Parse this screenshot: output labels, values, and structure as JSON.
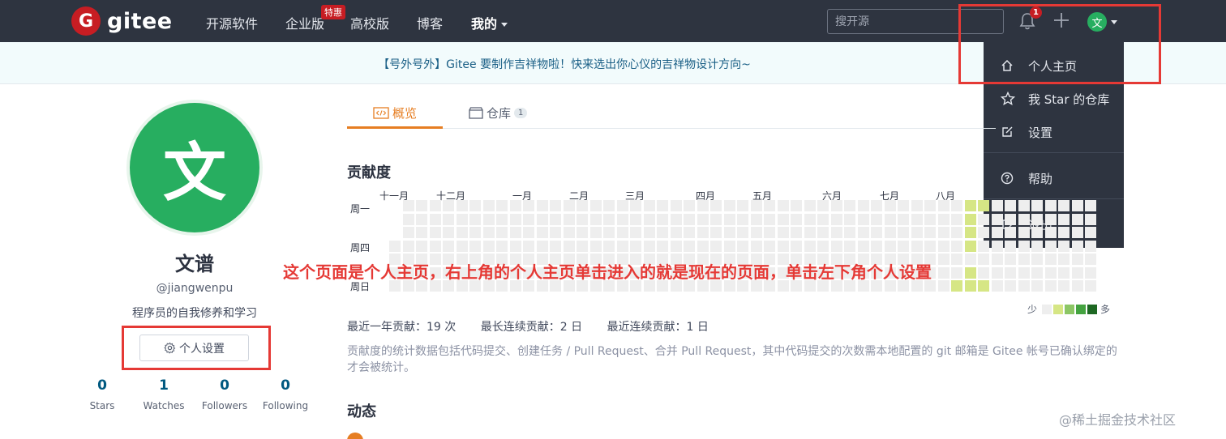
{
  "navbar": {
    "logo_text": "gitee",
    "items": [
      "开源软件",
      "企业版",
      "高校版",
      "博客",
      "我的"
    ],
    "enterprise_badge": "特惠",
    "search_placeholder": "搜开源",
    "notification_count": "1",
    "avatar_initial": "文"
  },
  "announcement": "【号外号外】Gitee 要制作吉祥物啦！快来选出你心仪的吉祥物设计方向~",
  "dropdown": {
    "items": [
      "个人主页",
      "我 Star 的仓库",
      "设置",
      "帮助",
      "退出"
    ]
  },
  "profile": {
    "avatar_initial": "文",
    "name": "文谱",
    "username": "@jiangwenpu",
    "bio": "程序员的自我修养和学习",
    "settings_label": "个人设置",
    "stats": [
      {
        "value": "0",
        "label": "Stars"
      },
      {
        "value": "1",
        "label": "Watches"
      },
      {
        "value": "0",
        "label": "Followers"
      },
      {
        "value": "0",
        "label": "Following"
      }
    ]
  },
  "tabs": [
    {
      "label": "概览"
    },
    {
      "label": "仓库",
      "count": "1"
    }
  ],
  "contribution": {
    "title": "贡献度",
    "months": [
      "十一月",
      "十二月",
      "一月",
      "二月",
      "三月",
      "四月",
      "五月",
      "六月",
      "七月",
      "八月"
    ],
    "weekdays": [
      "周一",
      "周四",
      "周日"
    ],
    "legend_less": "少",
    "legend_more": "多",
    "summary": [
      "最近一年贡献：19 次",
      "最长连续贡献：2 日",
      "最近连续贡献：1 日"
    ],
    "note": "贡献度的统计数据包括代码提交、创建任务 / Pull Request、合并 Pull Request，其中代码提交的次数需本地配置的 git 邮箱是 Gitee 帐号已确认绑定的才会被统计。",
    "colors": {
      "empty": "#eeeeee",
      "level1": "#d6e685",
      "level2": "#8cc665",
      "level3": "#44a340",
      "level4": "#1e6823"
    }
  },
  "activity_title": "动态",
  "annotation": "这个页面是个人主页，右上角的个人主页单击进入的就是现在的页面，单击左下角个人设置",
  "watermark": "@稀土掘金技术社区"
}
